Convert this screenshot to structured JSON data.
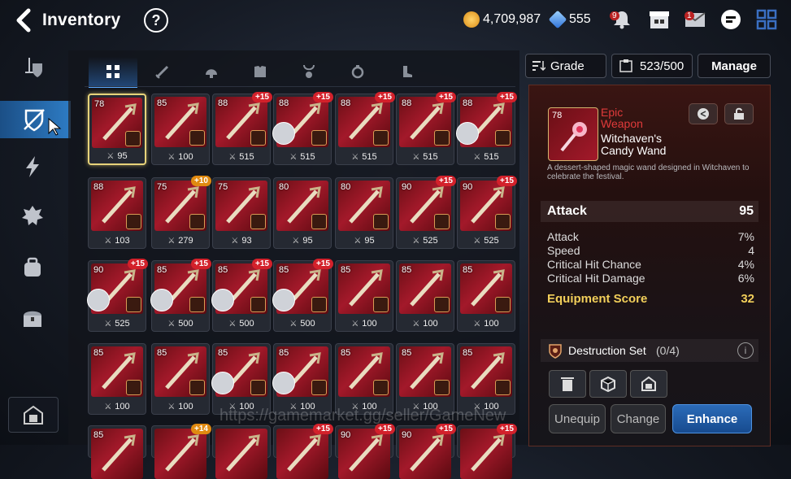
{
  "header": {
    "title": "Inventory",
    "help_label": "?",
    "gold": "4,709,987",
    "crystals": "555",
    "notif_badge": "9",
    "mail_badge": "1"
  },
  "sidebar": {
    "items": [
      "weapon-armor",
      "artifact",
      "boost",
      "materials",
      "storage",
      "chest"
    ],
    "active": "artifact"
  },
  "tabs": [
    "all",
    "weapon",
    "helmet",
    "armor",
    "necklace",
    "ring",
    "boots"
  ],
  "filter": {
    "grade_label": "Grade",
    "capacity": "523/500",
    "manage_label": "Manage"
  },
  "items": [
    {
      "lvl": "78",
      "enh": "",
      "val": "95",
      "sel": true,
      "hero": false
    },
    {
      "lvl": "85",
      "enh": "",
      "val": "100",
      "hero": false
    },
    {
      "lvl": "88",
      "enh": "+15",
      "val": "515",
      "hero": false
    },
    {
      "lvl": "88",
      "enh": "+15",
      "val": "515",
      "hero": true
    },
    {
      "lvl": "88",
      "enh": "+15",
      "val": "515",
      "hero": false
    },
    {
      "lvl": "88",
      "enh": "+15",
      "val": "515",
      "hero": false
    },
    {
      "lvl": "88",
      "enh": "+15",
      "val": "515",
      "hero": true
    },
    {
      "lvl": "88",
      "enh": "",
      "val": "103",
      "hero": false
    },
    {
      "lvl": "75",
      "enh": "+10",
      "enh_gold": true,
      "val": "279",
      "hero": false
    },
    {
      "lvl": "75",
      "enh": "",
      "val": "93",
      "hero": false
    },
    {
      "lvl": "80",
      "enh": "",
      "val": "95",
      "hero": false
    },
    {
      "lvl": "80",
      "enh": "",
      "val": "95",
      "hero": false
    },
    {
      "lvl": "90",
      "enh": "+15",
      "val": "525",
      "hero": false
    },
    {
      "lvl": "90",
      "enh": "+15",
      "val": "525",
      "hero": false
    },
    {
      "lvl": "90",
      "enh": "+15",
      "val": "525",
      "hero": true
    },
    {
      "lvl": "85",
      "enh": "+15",
      "val": "500",
      "hero": true
    },
    {
      "lvl": "85",
      "enh": "+15",
      "val": "500",
      "hero": true
    },
    {
      "lvl": "85",
      "enh": "+15",
      "val": "500",
      "hero": true
    },
    {
      "lvl": "85",
      "enh": "",
      "val": "100",
      "hero": false
    },
    {
      "lvl": "85",
      "enh": "",
      "val": "100",
      "hero": false
    },
    {
      "lvl": "85",
      "enh": "",
      "val": "100",
      "hero": false
    },
    {
      "lvl": "85",
      "enh": "",
      "val": "100",
      "hero": false
    },
    {
      "lvl": "85",
      "enh": "",
      "val": "100",
      "hero": false
    },
    {
      "lvl": "85",
      "enh": "",
      "val": "100",
      "hero": true
    },
    {
      "lvl": "85",
      "enh": "",
      "val": "100",
      "hero": true
    },
    {
      "lvl": "85",
      "enh": "",
      "val": "100",
      "hero": false
    },
    {
      "lvl": "85",
      "enh": "",
      "val": "100",
      "hero": false
    },
    {
      "lvl": "85",
      "enh": "",
      "val": "100",
      "hero": false
    },
    {
      "lvl": "85",
      "enh": "",
      "val": "",
      "hero": false
    },
    {
      "lvl": "",
      "enh": "+14",
      "enh_gold": true,
      "val": "",
      "hero": false
    },
    {
      "lvl": "",
      "enh": "",
      "val": "",
      "hero": false
    },
    {
      "lvl": "",
      "enh": "+15",
      "val": "",
      "hero": false
    },
    {
      "lvl": "90",
      "enh": "+15",
      "val": "",
      "hero": false
    },
    {
      "lvl": "90",
      "enh": "+15",
      "val": "",
      "hero": false
    },
    {
      "lvl": "",
      "enh": "+15",
      "val": "",
      "hero": false
    }
  ],
  "detail": {
    "level": "78",
    "grade_line1": "Epic",
    "grade_line2": "Weapon",
    "name_line1": "Witchaven's",
    "name_line2": "Candy Wand",
    "desc": "A dessert-shaped magic wand designed in Witchaven to celebrate the festival.",
    "main_stat": {
      "label": "Attack",
      "value": "95"
    },
    "substats": [
      {
        "label": "Attack",
        "value": "7%"
      },
      {
        "label": "Speed",
        "value": "4"
      },
      {
        "label": "Critical Hit Chance",
        "value": "4%"
      },
      {
        "label": "Critical Hit Damage",
        "value": "6%"
      }
    ],
    "score": {
      "label": "Equipment Score",
      "value": "32"
    },
    "set": {
      "label": "Destruction Set",
      "count": "(0/4)"
    },
    "buttons": {
      "unequip": "Unequip",
      "change": "Change",
      "enhance": "Enhance"
    }
  },
  "watermark": "https://gamemarket.gg/seller/GameNew",
  "colors": {
    "accent": "#2d7ac2",
    "gold_text": "#f2cf5a",
    "epic_red": "#e03a3a",
    "panel": "#24100f"
  }
}
